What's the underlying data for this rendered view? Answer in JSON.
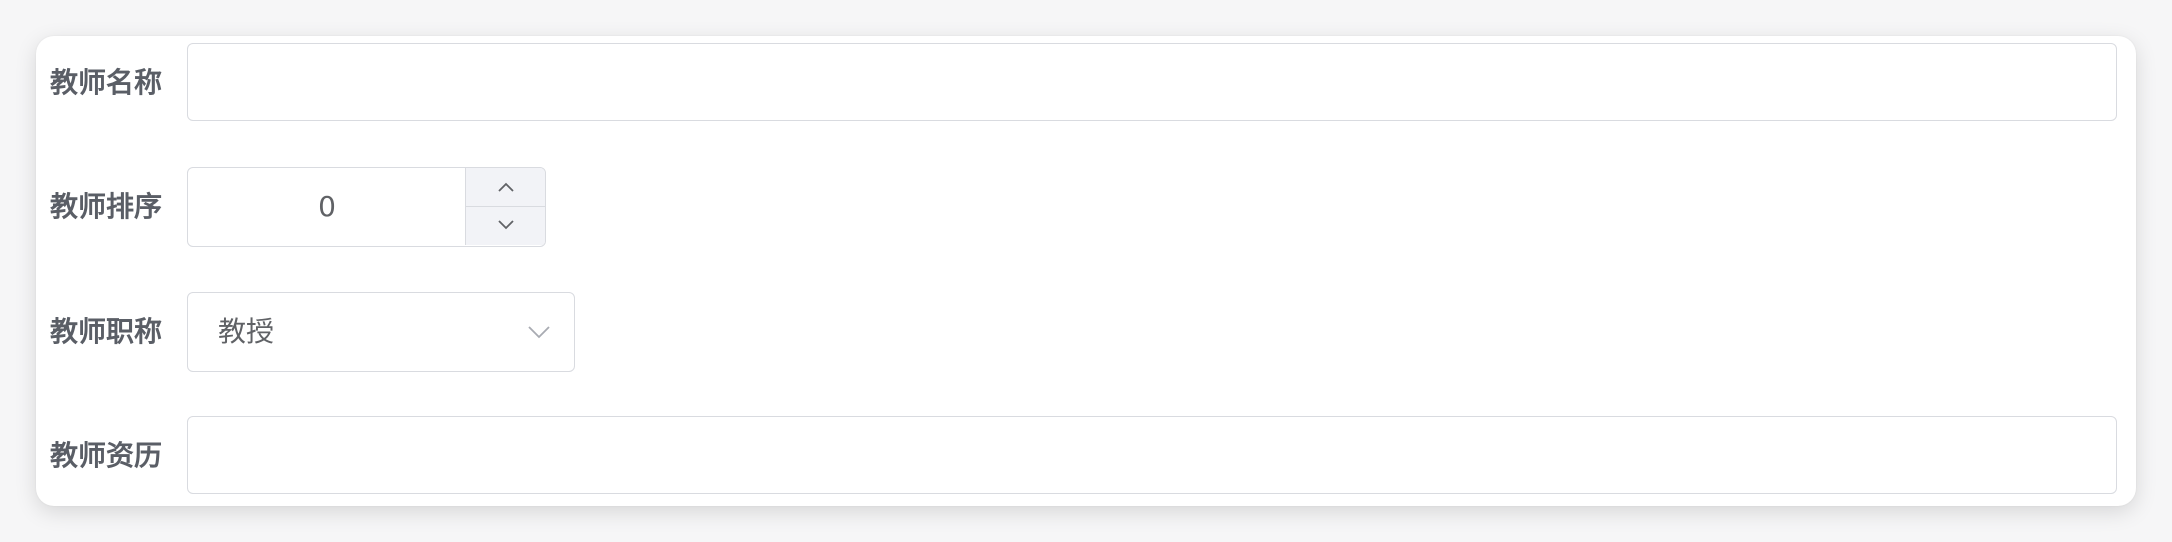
{
  "form": {
    "teacher_name": {
      "label": "教师名称",
      "value": ""
    },
    "teacher_order": {
      "label": "教师排序",
      "value": "0"
    },
    "teacher_title": {
      "label": "教师职称",
      "value": "教授"
    },
    "teacher_bio": {
      "label": "教师资历",
      "value": ""
    }
  },
  "icons": {
    "increase": "chevron-up-icon",
    "decrease": "chevron-down-icon",
    "select_arrow": "chevron-down-icon"
  },
  "colors": {
    "label": "#5a5e66",
    "border": "#d9dbe0",
    "stepper_bg": "#f2f3f7"
  }
}
